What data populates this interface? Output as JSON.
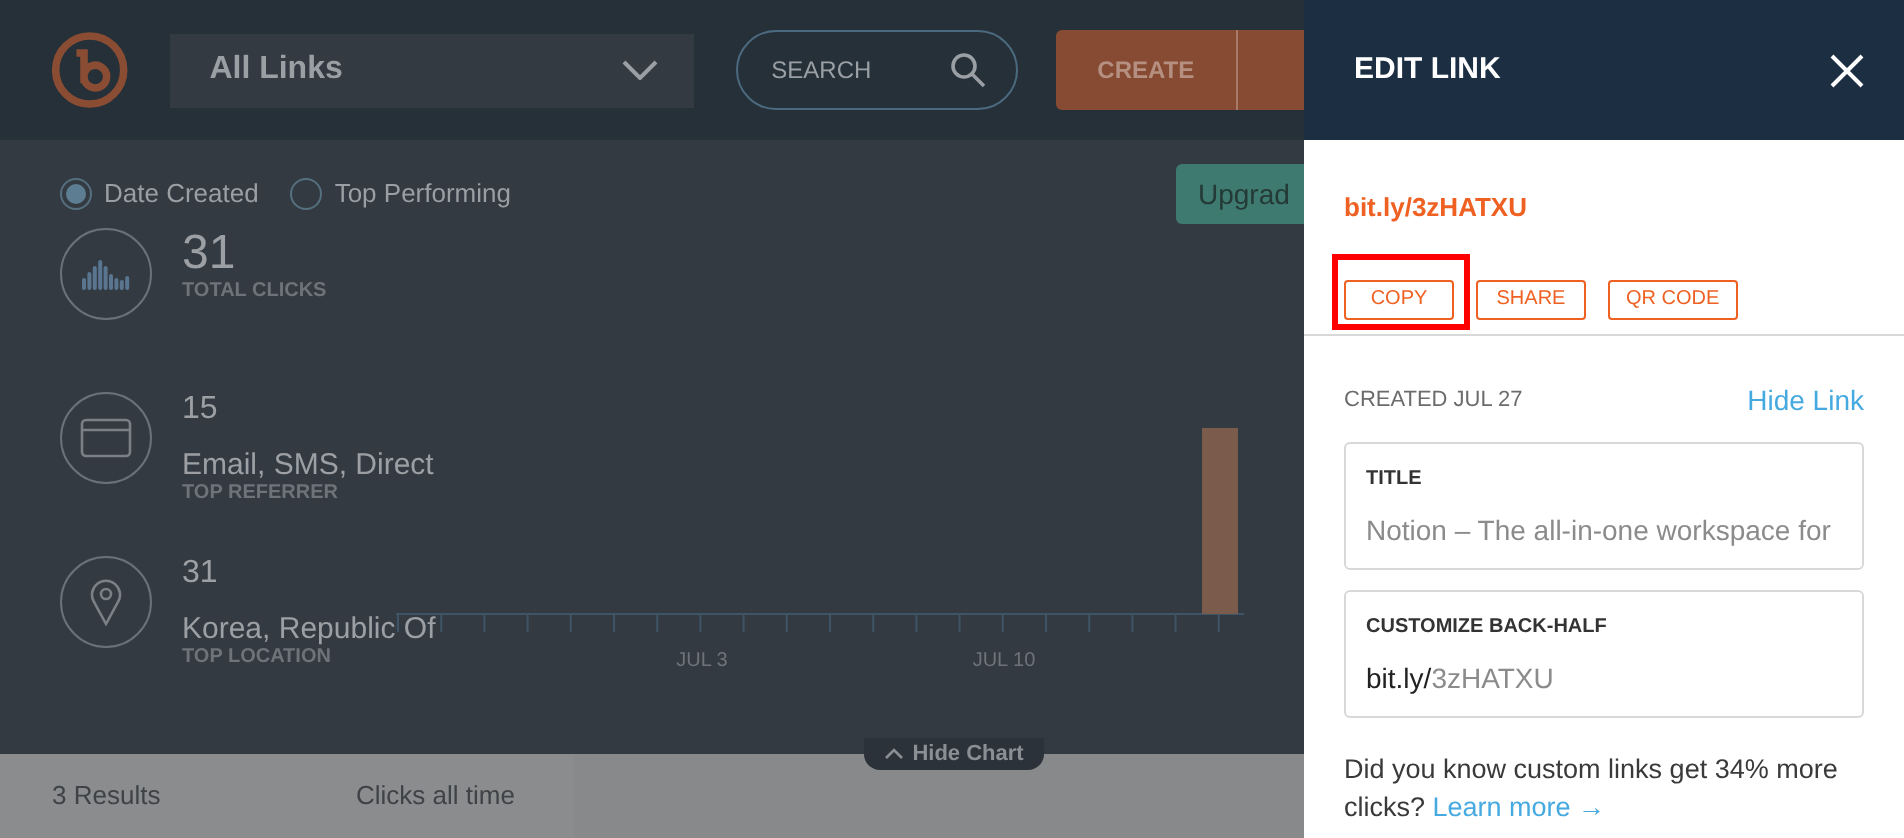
{
  "header": {
    "view_select": {
      "value": "All Links"
    },
    "search": {
      "placeholder": "SEARCH"
    },
    "create_button": "CREATE"
  },
  "sort_options": [
    {
      "label": "Date Created",
      "selected": true
    },
    {
      "label": "Top Performing",
      "selected": false
    }
  ],
  "upgrade_button": "Upgrad",
  "stats": [
    {
      "kind": "clicks",
      "value": "31",
      "label": "TOTAL CLICKS"
    },
    {
      "kind": "referrer",
      "value": "15",
      "detail": "Email, SMS, Direct",
      "label": "TOP REFERRER"
    },
    {
      "kind": "location",
      "value": "31",
      "detail": "Korea, Republic Of",
      "label": "TOP LOCATION"
    }
  ],
  "chart": {
    "x_labels": [
      "JUL 3",
      "JUL 10"
    ]
  },
  "hide_chart": "Hide Chart",
  "list_header": {
    "results": "3 Results",
    "clicks": "Clicks all time"
  },
  "panel": {
    "title": "EDIT LINK",
    "short_link": "bit.ly/3zHATXU",
    "actions": [
      {
        "label": "COPY",
        "highlighted": true
      },
      {
        "label": "SHARE",
        "highlighted": false
      },
      {
        "label": "QR CODE",
        "highlighted": false
      }
    ],
    "created": "CREATED JUL 27",
    "hide_link": "Hide Link",
    "fields": [
      {
        "label": "TITLE",
        "value": "Notion – The all-in-one workspace for"
      },
      {
        "label": "CUSTOMIZE BACK-HALF",
        "prefix": "bit.ly/",
        "value": "3zHATXU"
      }
    ],
    "promo": {
      "text": "Did you know custom links get 34% more clicks?",
      "link": "Learn more →"
    }
  }
}
